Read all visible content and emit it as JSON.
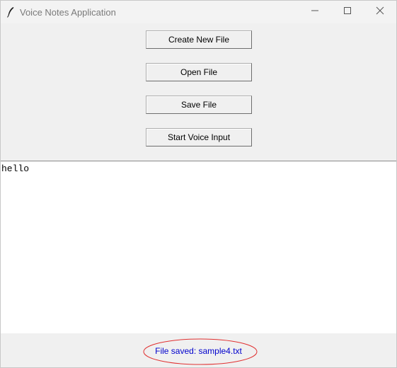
{
  "window": {
    "title": "Voice Notes Application",
    "app_icon": "feather-icon",
    "controls": [
      "minimize-icon",
      "maximize-icon",
      "close-icon"
    ]
  },
  "buttons": {
    "create_new_file": "Create New File",
    "open_file": "Open File",
    "save_file": "Save File",
    "start_voice_input": "Start Voice Input"
  },
  "editor": {
    "content": "hello"
  },
  "status": {
    "message": "File saved: sample4.txt",
    "color": "#0000cc",
    "highlight_color": "#e03030"
  }
}
